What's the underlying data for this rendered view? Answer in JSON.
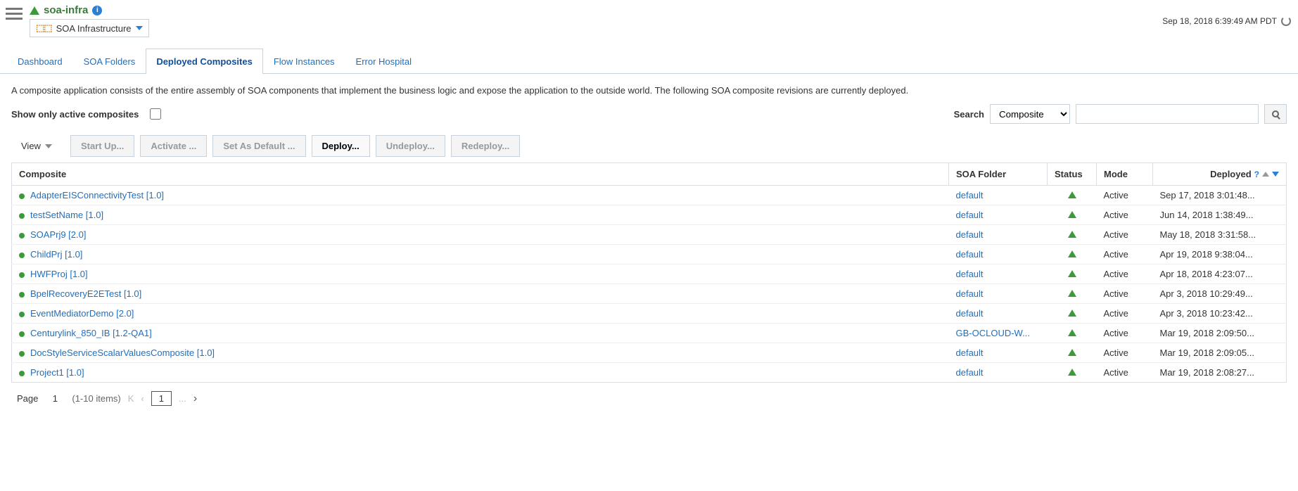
{
  "header": {
    "page_title": "soa-infra",
    "subtitle": "SOA Infrastructure",
    "timestamp": "Sep 18, 2018 6:39:49 AM PDT"
  },
  "tabs": [
    {
      "label": "Dashboard",
      "active": false
    },
    {
      "label": "SOA Folders",
      "active": false
    },
    {
      "label": "Deployed Composites",
      "active": true
    },
    {
      "label": "Flow Instances",
      "active": false
    },
    {
      "label": "Error Hospital",
      "active": false
    }
  ],
  "description": "A composite application consists of the entire assembly of SOA components that implement the business logic and expose the application to the outside world. The following SOA composite revisions are currently deployed.",
  "show_only_label": "Show only active composites",
  "search": {
    "label": "Search",
    "type_selected": "Composite",
    "value": ""
  },
  "toolbar": {
    "view_label": "View",
    "buttons": {
      "startup": "Start Up...",
      "activate": "Activate ...",
      "setdefault": "Set As Default ...",
      "deploy": "Deploy...",
      "undeploy": "Undeploy...",
      "redeploy": "Redeploy..."
    }
  },
  "columns": {
    "composite": "Composite",
    "folder": "SOA Folder",
    "status": "Status",
    "mode": "Mode",
    "deployed": "Deployed"
  },
  "rows": [
    {
      "name": "AdapterEISConnectivityTest [1.0]",
      "folder": "default",
      "mode": "Active",
      "deployed": "Sep 17, 2018 3:01:48..."
    },
    {
      "name": "testSetName [1.0]",
      "folder": "default",
      "mode": "Active",
      "deployed": "Jun 14, 2018 1:38:49..."
    },
    {
      "name": "SOAPrj9 [2.0]",
      "folder": "default",
      "mode": "Active",
      "deployed": "May 18, 2018 3:31:58..."
    },
    {
      "name": "ChildPrj [1.0]",
      "folder": "default",
      "mode": "Active",
      "deployed": "Apr 19, 2018 9:38:04..."
    },
    {
      "name": "HWFProj [1.0]",
      "folder": "default",
      "mode": "Active",
      "deployed": "Apr 18, 2018 4:23:07..."
    },
    {
      "name": "BpelRecoveryE2ETest [1.0]",
      "folder": "default",
      "mode": "Active",
      "deployed": "Apr 3, 2018 10:29:49..."
    },
    {
      "name": "EventMediatorDemo [2.0]",
      "folder": "default",
      "mode": "Active",
      "deployed": "Apr 3, 2018 10:23:42..."
    },
    {
      "name": "Centurylink_850_IB [1.2-QA1]",
      "folder": "GB-OCLOUD-W...",
      "mode": "Active",
      "deployed": "Mar 19, 2018 2:09:50..."
    },
    {
      "name": "DocStyleServiceScalarValuesComposite [1.0]",
      "folder": "default",
      "mode": "Active",
      "deployed": "Mar 19, 2018 2:09:05..."
    },
    {
      "name": "Project1 [1.0]",
      "folder": "default",
      "mode": "Active",
      "deployed": "Mar 19, 2018 2:08:27..."
    }
  ],
  "pager": {
    "label": "Page",
    "page": "1",
    "items": "(1-10 items)",
    "first": "K",
    "current": "1",
    "ellipsis": "..."
  }
}
